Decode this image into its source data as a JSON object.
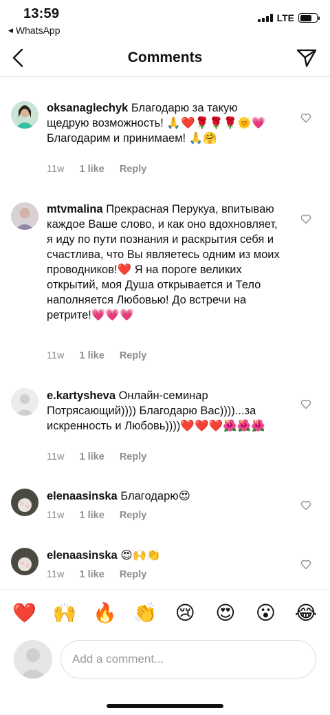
{
  "status_bar": {
    "time": "13:59",
    "back_app": "WhatsApp",
    "network": "LTE",
    "battery_level": 0.7
  },
  "nav": {
    "title": "Comments"
  },
  "comments": [
    {
      "username": "oksanaglechyk",
      "text": "Благодарю за такую щедрую возможность! 🙏❤️🌹🌹🌹🌞💗 Благодарим и принимаем! 🙏🤗",
      "age": "11w",
      "likes": "1 like",
      "reply": "Reply"
    },
    {
      "username": "mtvmalina",
      "text": "Прекрасная Перукуа, впитываю каждое Ваше слово, и как оно вдохновляет, я иду по пути познания и раскрытия себя и счастлива, что Вы являетесь одним из моих проводников!❤️ Я на пороге великих открытий, моя Душа открывается и Тело наполняется Любовью! До встречи на ретрите!💗💗💗",
      "age": "11w",
      "likes": "1 like",
      "reply": "Reply"
    },
    {
      "username": "e.kartysheva",
      "text": "Онлайн-семинар Потрясающий)))) Благодарю Вас))))...за искренность и Любовь))))❤️❤️❤️🌺🌺🌺",
      "age": "11w",
      "likes": "1 like",
      "reply": "Reply"
    },
    {
      "username": "elenaasinska",
      "text": "Благодарю😍",
      "age": "11w",
      "likes": "1 like",
      "reply": "Reply"
    },
    {
      "username": "elenaasinska",
      "text": "😍🙌👏",
      "age": "11w",
      "likes": "1 like",
      "reply": "Reply"
    }
  ],
  "reactions": [
    "❤️",
    "🙌",
    "🔥",
    "👏",
    "😢",
    "😍",
    "😮",
    "😂"
  ],
  "input": {
    "placeholder": "Add a comment..."
  },
  "icons": {
    "back": "chevron-left-icon",
    "share": "paper-plane-icon",
    "like": "heart-outline-icon"
  }
}
